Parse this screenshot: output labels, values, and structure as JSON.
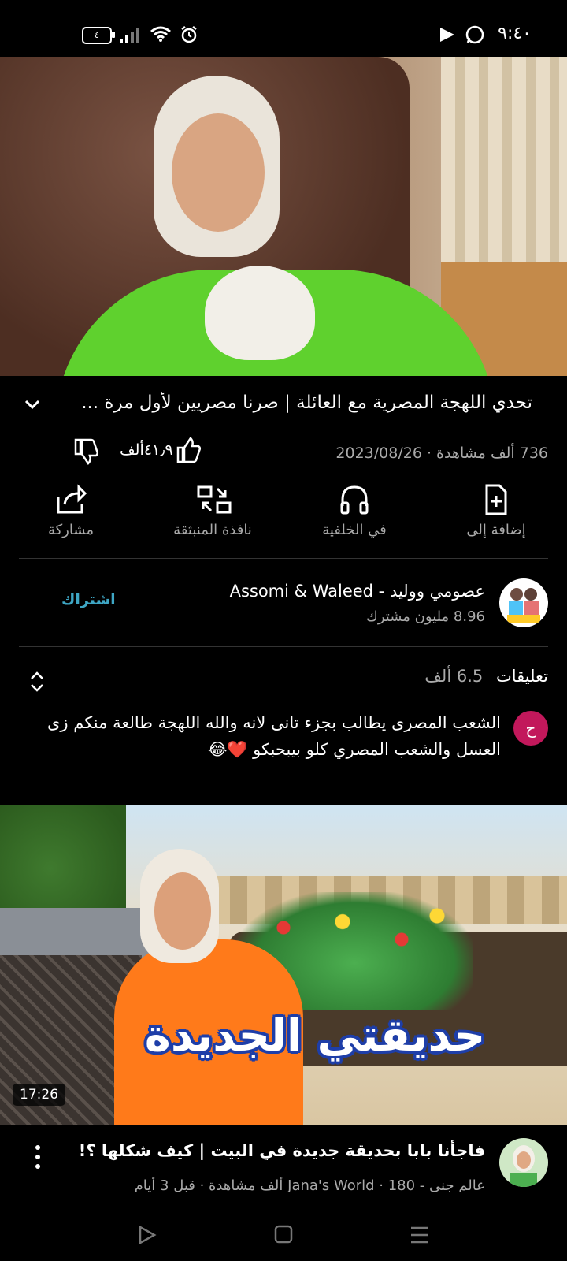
{
  "status_bar": {
    "time": "٩:٤٠",
    "battery": "٤",
    "icons": [
      "youtube-icon",
      "whatsapp-icon",
      "alarm-icon",
      "wifi-icon",
      "signal-icon",
      "battery-icon"
    ]
  },
  "video": {
    "title": "تحدي اللهجة المصرية مع العائلة | صرنا مصريين لأول مرة ...",
    "views": "736 ألف مشاهدة",
    "date": "2023/08/26",
    "meta": "736 ألف مشاهدة · 2023/08/26",
    "likes": "٤١٫٩ألف"
  },
  "actions": [
    {
      "label": "إضافة إلى",
      "icon": "add-to-playlist-icon"
    },
    {
      "label": "في الخلفية",
      "icon": "headphones-icon"
    },
    {
      "label": "نافذة المنبثقة",
      "icon": "picture-in-picture-icon"
    },
    {
      "label": "مشاركة",
      "icon": "share-icon"
    }
  ],
  "channel": {
    "name": "عصومي ووليد - Assomi & Waleed",
    "subscribers": "8.96 مليون مشترك",
    "subscribe_label": "اشتراك"
  },
  "comments": {
    "label": "تعليقات",
    "count": "6.5 ألف",
    "top_comment": {
      "avatar_letter": "ح",
      "text": "الشعب المصرى يطالب بجزء تانى لانه والله اللهجة طالعة منكم زى العسل والشعب المصري كلو بيبحبكو ❤️😂"
    }
  },
  "next_video": {
    "overlay_text": "حديقتي الجديدة",
    "duration": "17:26",
    "title": "فاجأنا بابا بحديقة جديدة في البيت | كيف شكلها ؟!",
    "meta": "عالم جنى - Jana's World · 180 ألف مشاهدة · قبل 3 أيام"
  },
  "colors": {
    "background": "#000000",
    "subscribe_accent": "#3ea6c4",
    "comment_avatar": "#c2185b"
  }
}
